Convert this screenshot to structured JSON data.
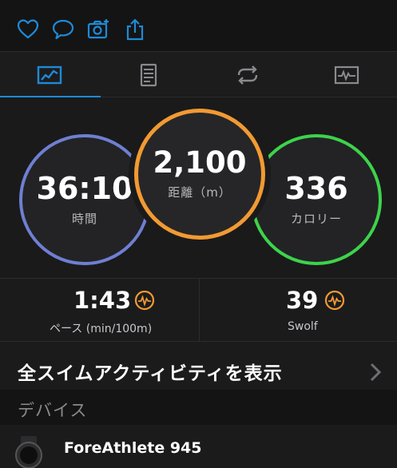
{
  "actions": [
    {
      "name": "heart-icon"
    },
    {
      "name": "comment-icon"
    },
    {
      "name": "camera-add-icon"
    },
    {
      "name": "share-icon"
    }
  ],
  "tabs": [
    {
      "name": "tab-overview",
      "icon": "overview-chart-icon",
      "selected": true
    },
    {
      "name": "tab-stats",
      "icon": "document-list-icon",
      "selected": false
    },
    {
      "name": "tab-laps",
      "icon": "loop-icon",
      "selected": false
    },
    {
      "name": "tab-charts",
      "icon": "heartbeat-graph-icon",
      "selected": false
    }
  ],
  "rings": {
    "time": {
      "value": "36:10",
      "label": "時間",
      "color": "#6f7fd2"
    },
    "distance": {
      "value": "2,100",
      "label": "距離（m）",
      "color": "#f29a32"
    },
    "calories": {
      "value": "336",
      "label": "カロリー",
      "color": "#3dd34a"
    }
  },
  "stats": {
    "pace": {
      "value": "1:43",
      "label": "ペース (min/100m)",
      "icon": "pulse-icon"
    },
    "swolf": {
      "value": "39",
      "label": "Swolf",
      "icon": "pulse-icon"
    }
  },
  "show_all": {
    "label": "全スイムアクティビティを表示"
  },
  "devices": {
    "header": "デバイス",
    "item": {
      "name": "ForeAthlete 945"
    }
  },
  "colors": {
    "accent": "#1f8ad6",
    "pulse": "#f29a32"
  }
}
